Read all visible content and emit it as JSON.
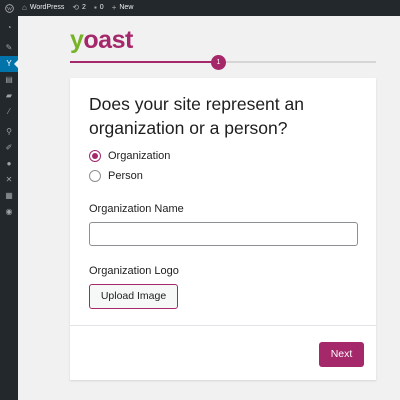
{
  "admin_bar": {
    "site_name": "WordPress",
    "updates_count": "2",
    "comments_count": "0",
    "new_label": "New"
  },
  "sidebar": {
    "items": [
      {
        "icon": "dashboard-icon",
        "active": false
      },
      {
        "icon": "posts-pin-icon",
        "active": false
      },
      {
        "icon": "yoast-seo-icon",
        "active": true
      },
      {
        "icon": "pages-icon",
        "active": false
      },
      {
        "icon": "comments-icon",
        "active": false
      },
      {
        "icon": "appearance-brush-icon",
        "active": false
      },
      {
        "icon": "plugins-icon",
        "active": false
      },
      {
        "icon": "tools-icon",
        "active": false
      },
      {
        "icon": "users-icon",
        "active": false
      },
      {
        "icon": "wrench-icon",
        "active": false
      },
      {
        "icon": "settings-icon",
        "active": false
      },
      {
        "icon": "collapse-icon",
        "active": false
      }
    ]
  },
  "logo": {
    "first_letter": "y",
    "rest": "oast"
  },
  "progress": {
    "current_step": "1",
    "fraction": 0.48
  },
  "wizard": {
    "question": "Does your site represent an organization or a person?",
    "options": [
      {
        "label": "Organization",
        "selected": true
      },
      {
        "label": "Person",
        "selected": false
      }
    ],
    "org_name_label": "Organization Name",
    "org_name_value": "",
    "org_logo_label": "Organization Logo",
    "upload_button": "Upload Image",
    "next_button": "Next"
  },
  "colors": {
    "brand_purple": "#a4286a",
    "brand_green": "#77b227",
    "admin_dark": "#23282d",
    "admin_blue": "#0073aa"
  }
}
